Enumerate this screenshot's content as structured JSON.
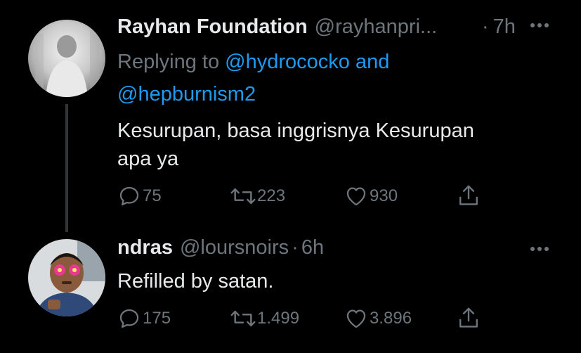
{
  "tweets": [
    {
      "display_name": "Rayhan Foundation",
      "handle": "@rayhanpri...",
      "time": "7h",
      "separator": "·",
      "replying_prefix": "Replying to",
      "replying_user1": "@hydrococko",
      "replying_and": "and",
      "replying_user2": "@hepburnism2",
      "text_line1": "Kesurupan, basa inggrisnya Kesurupan",
      "text_line2": "apa ya",
      "reply_count": "75",
      "retweet_count": "223",
      "like_count": "930"
    },
    {
      "display_name": "ndras",
      "handle": "@loursnoirs",
      "separator": "·",
      "time": "6h",
      "text_line1": "Refilled by satan.",
      "reply_count": "175",
      "retweet_count": "1.499",
      "like_count": "3.896"
    }
  ],
  "icons": {
    "more": "more-horizontal-icon",
    "reply": "reply-bubble-icon",
    "retweet": "retweet-arrows-icon",
    "like": "heart-icon",
    "share": "share-upload-icon"
  },
  "colors": {
    "background": "#000000",
    "text": "#e7e9ea",
    "muted": "#6e767d",
    "link": "#1d9bf0"
  }
}
